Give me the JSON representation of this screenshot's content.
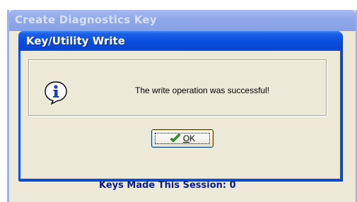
{
  "parent_window": {
    "title": "Create Diagnostics Key",
    "footer_text": "Keys Made This Session: 0"
  },
  "dialog": {
    "title": "Key/Utility Write",
    "message": "The write operation was successful!",
    "icon": "info-icon",
    "ok_button": {
      "label": "OK",
      "icon": "checkmark-icon"
    }
  },
  "colors": {
    "title_bar_active": "#0a4fe0",
    "title_bar_inactive": "#8fa8ea",
    "dialog_background": "#ece9d8",
    "footer_text": "#0a1c8c",
    "checkmark": "#2a9d1c"
  }
}
